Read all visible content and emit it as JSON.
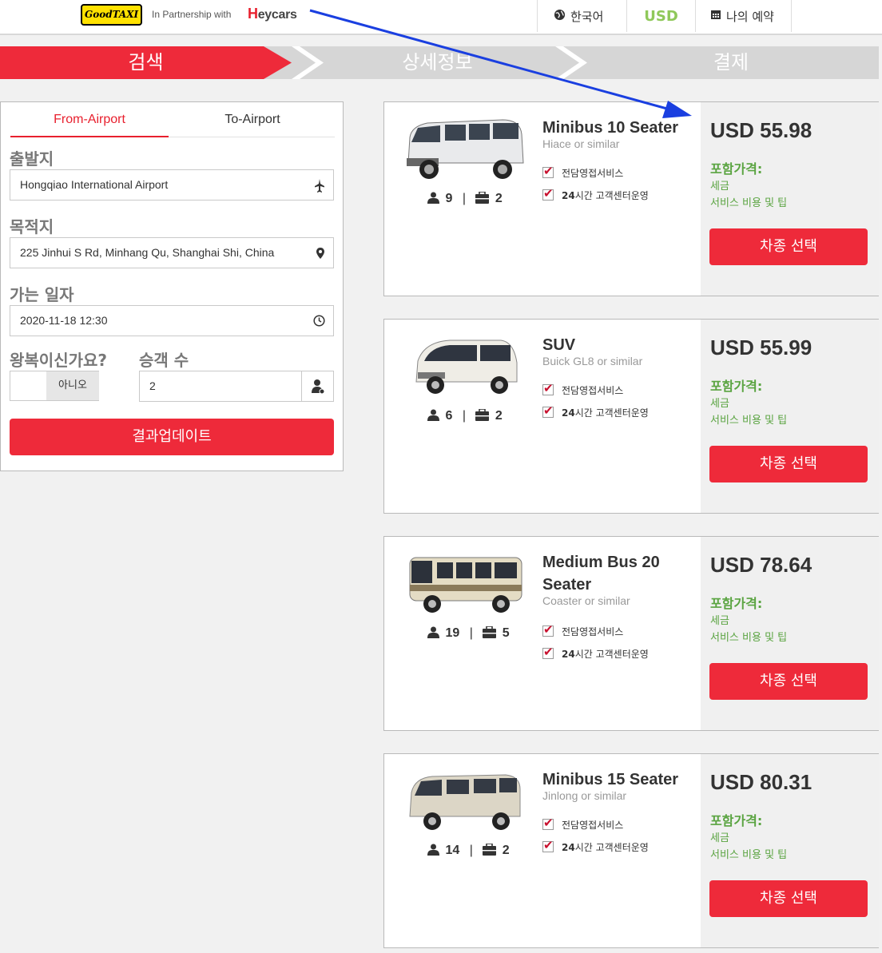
{
  "header": {
    "logo_text": "GoodTAXI",
    "partnership": "In Partnership with",
    "partner_brand_h": "H",
    "partner_brand_rest": "eycars",
    "language": "한국어",
    "currency": "USD",
    "bookings": "나의 예약",
    "icons": {
      "language": "globe-icon",
      "bookings": "calendar-icon"
    }
  },
  "steps": [
    {
      "label": "검색",
      "active": true
    },
    {
      "label": "상세정보",
      "active": false
    },
    {
      "label": "결제",
      "active": false
    }
  ],
  "search": {
    "tabs": [
      "From-Airport",
      "To-Airport"
    ],
    "active_tab": "From-Airport",
    "origin_label": "출발지",
    "origin_value": "Hongqiao International Airport",
    "destination_label": "목적지",
    "destination_value": "225 Jinhui S Rd, Minhang Qu, Shanghai Shi, China",
    "date_label": "가는 일자",
    "date_value": "2020-11-18 12:30",
    "roundtrip_label": "왕복이신가요?",
    "roundtrip_value": "아니오",
    "passengers_label": "승객 수",
    "passengers_value": "2",
    "update_button": "결과업데이트"
  },
  "vehicles": [
    {
      "name": "Minibus 10 Seater",
      "similar": "Hiace or similar",
      "passengers": "9",
      "luggage": "2",
      "price": "USD 55.98"
    },
    {
      "name": "SUV",
      "similar": "Buick GL8 or similar",
      "passengers": "6",
      "luggage": "2",
      "price": "USD 55.99"
    },
    {
      "name": "Medium Bus 20 Seater",
      "similar": "Coaster or similar",
      "passengers": "19",
      "luggage": "5",
      "price": "USD 78.64"
    },
    {
      "name": "Minibus 15 Seater",
      "similar": "Jinlong or similar",
      "passengers": "14",
      "luggage": "2",
      "price": "USD 80.31"
    }
  ],
  "vehicle_common": {
    "feature_1": "전담영접서비스",
    "feature_2_bold": "24",
    "feature_2_rest": "시간 고객센터운영",
    "included_label": "포함가격:",
    "included_1": "세금",
    "included_2": "서비스 비용 및 팁",
    "select_button": "차종 선택"
  },
  "colors": {
    "brand_red": "#ee2a3a",
    "included_green": "#5aa441",
    "currency_green": "#8fc85a",
    "annotation_arrow": "#1a3fe0"
  }
}
